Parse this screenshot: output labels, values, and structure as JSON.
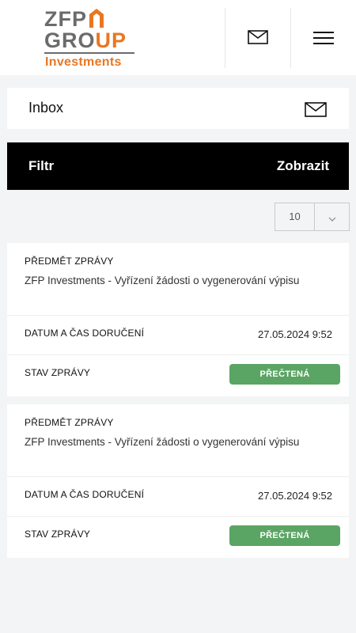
{
  "header": {
    "logo": {
      "line1": "ZFP",
      "line2a": "GRO",
      "line2b": "UP",
      "line3": "Investments"
    },
    "icons": {
      "mail": "mail-icon",
      "menu": "hamburger-menu-icon"
    }
  },
  "inbox": {
    "title": "Inbox",
    "icon": "mail-icon"
  },
  "filter": {
    "label": "Filtr",
    "show_label": "Zobrazit"
  },
  "page_size": {
    "value": "10",
    "icon": "chevron-down-icon"
  },
  "messages": [
    {
      "subject_label": "PŘEDMĚT ZPRÁVY",
      "subject": "ZFP Investments - Vyřízení žádosti o vygenerování výpisu",
      "date_label": "DATUM A ČAS DORUČENÍ",
      "date": "27.05.2024 9:52",
      "status_label": "STAV ZPRÁVY",
      "status": "PŘEČTENÁ"
    },
    {
      "subject_label": "PŘEDMĚT ZPRÁVY",
      "subject": "ZFP Investments - Vyřízení žádosti o vygenerování výpisu",
      "date_label": "DATUM A ČAS DORUČENÍ",
      "date": "27.05.2024 9:52",
      "status_label": "STAV ZPRÁVY",
      "status": "PŘEČTENÁ"
    }
  ],
  "colors": {
    "accent": "#e87722",
    "logo_gray": "#6b6b6b",
    "status_read": "#5aa464",
    "filter_bg": "#000000",
    "page_bg": "#f3f4f6"
  }
}
